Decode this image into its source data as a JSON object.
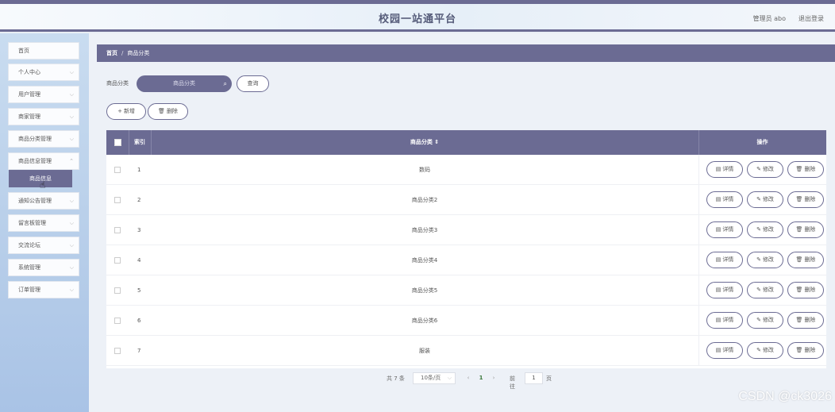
{
  "header": {
    "title": "校园一站通平台",
    "user": "管理员 abo",
    "logout": "退出登录"
  },
  "sidebar": {
    "items": [
      {
        "label": "首页",
        "has_arrow": false
      },
      {
        "label": "个人中心",
        "has_arrow": true
      },
      {
        "label": "用户管理",
        "has_arrow": true
      },
      {
        "label": "商家管理",
        "has_arrow": true
      },
      {
        "label": "商品分类管理",
        "has_arrow": true
      },
      {
        "label": "商品信息管理",
        "has_arrow": true
      },
      {
        "label": "通知公告管理",
        "has_arrow": true
      },
      {
        "label": "留言板管理",
        "has_arrow": true
      },
      {
        "label": "交流论坛",
        "has_arrow": true
      },
      {
        "label": "系统管理",
        "has_arrow": true
      },
      {
        "label": "订单管理",
        "has_arrow": true
      }
    ],
    "submenu_active": "商品信息"
  },
  "breadcrumb": {
    "home": "首页",
    "separator": "/",
    "current": "商品分类"
  },
  "search": {
    "label": "商品分类",
    "placeholder": "商品分类",
    "query_button": "查询"
  },
  "actions": {
    "add": "新增",
    "delete": "删除"
  },
  "table": {
    "headers": {
      "index": "索引",
      "category": "商品分类",
      "sort_icon": "⇕",
      "operations": "操作"
    },
    "rows": [
      {
        "index": "1",
        "name": "数码"
      },
      {
        "index": "2",
        "name": "商品分类2"
      },
      {
        "index": "3",
        "name": "商品分类3"
      },
      {
        "index": "4",
        "name": "商品分类4"
      },
      {
        "index": "5",
        "name": "商品分类5"
      },
      {
        "index": "6",
        "name": "商品分类6"
      },
      {
        "index": "7",
        "name": "服装"
      }
    ],
    "row_buttons": {
      "detail": "详情",
      "edit": "修改",
      "delete": "删除"
    }
  },
  "pagination": {
    "total": "共 7 条",
    "page_size": "10条/页",
    "current_page": "1",
    "goto_label": "前往",
    "goto_value": "1",
    "page_suffix": "页"
  },
  "watermark": "CSDN @ck3026",
  "colors": {
    "accent": "#6b6b93",
    "sidebar_bg": "#b6cde9",
    "page_bg": "#edf1f7"
  }
}
